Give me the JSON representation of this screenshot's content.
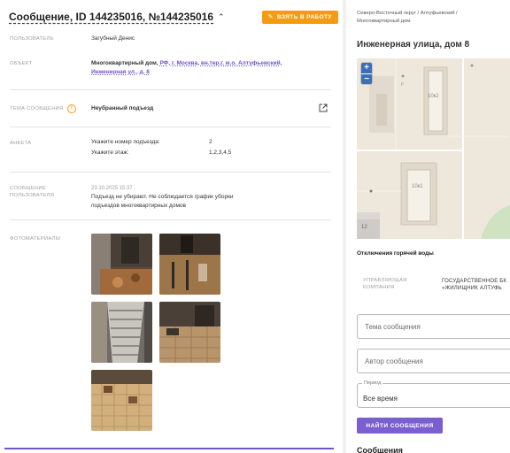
{
  "header": {
    "title": "Сообщение, ID 144235016, №144235016",
    "take_label": "ВЗЯТЬ В РАБОТУ"
  },
  "fields": {
    "user_label": "ПОЛЬЗОВАТЕЛЬ",
    "user_value": "Загубный Денис",
    "object_label": "ОБЪЕКТ",
    "object_type": "Многоквартирный дом,",
    "object_address_line1": "РФ, г. Москва, вн.тер.г. м.о. Алтуфьевский,",
    "object_address_line2": "Инженерная ул., д. 8",
    "topic_label": "ТЕМА СООБЩЕНИЯ",
    "topic_value": "Неубранный подъезд",
    "form_label": "АНКЕТА",
    "q1_label": "Укажите номер подъезда:",
    "q1_value": "2",
    "q2_label": "Укажите этаж:",
    "q2_value": "1,2,3,4,5",
    "message_label_1": "СООБЩЕНИЕ",
    "message_label_2": "ПОЛЬЗОВАТЕЛЯ",
    "message_date": "23.10.2025 15:37",
    "message_text_1": "Подъезд не убирают. Не соблюдается график уборки",
    "message_text_2": "подъездов многоквартирных домов",
    "photos_label": "ФОТОМАТЕРИАЛЫ"
  },
  "right": {
    "breadcrumb_1": "Северо-Восточный округ / Алтуфьевский /",
    "breadcrumb_2": "Многоквартирный дом",
    "place_title": "Инженерная улица, дом 8",
    "map_labels": {
      "b1": "10к2",
      "b2": "10к1",
      "n12": "12",
      "p": "р"
    },
    "outage_title": "Отключения горячей воды",
    "manager_label_1": "УПРАВЛЯЮЩАЯ",
    "manager_label_2": "КОМПАНИЯ",
    "manager_value_1": "ГОСУДАРСТВЕННОЕ БК",
    "manager_value_2": "«ЖИЛИЩНИК АЛТУФЬ",
    "topic_placeholder": "Тема сообщения",
    "author_placeholder": "Автор сообщения",
    "period_legend": "Период",
    "period_value": "Все время",
    "find_label": "НАЙТИ СООБЩЕНИЯ",
    "messages_heading": "Сообщения"
  },
  "colors": {
    "accent": "#7b5ecf",
    "warning": "#f39c12",
    "link": "#6f55c8"
  }
}
